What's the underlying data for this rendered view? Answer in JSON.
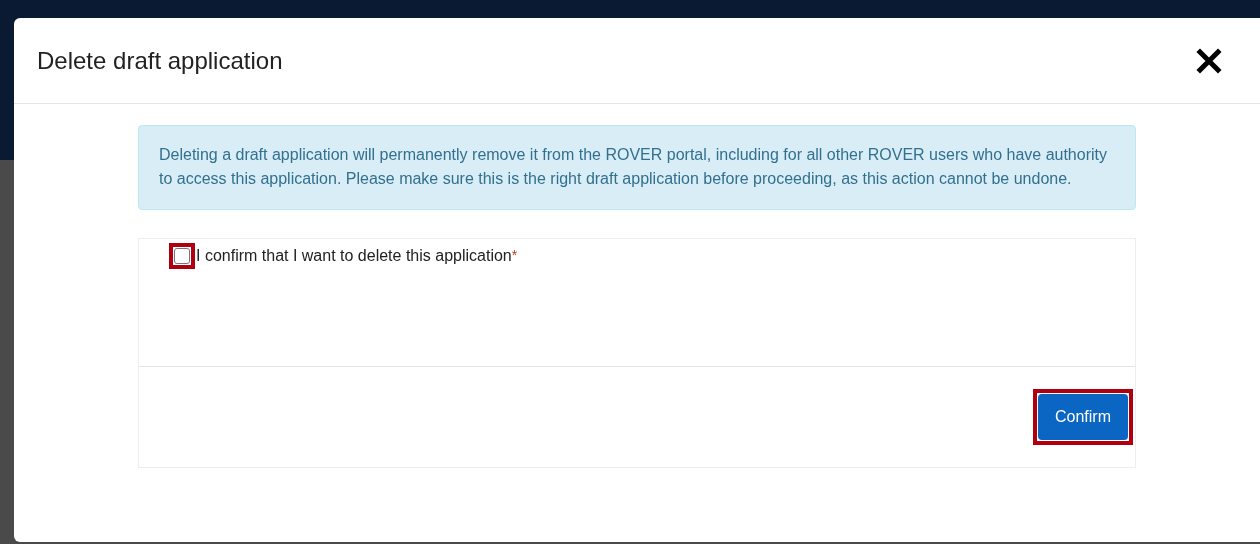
{
  "dialog": {
    "title": "Delete draft application"
  },
  "alert": {
    "text": "Deleting a draft application will permanently remove it from the ROVER portal, including for all other ROVER users who have authority to access this application. Please make sure this is the right draft application before proceeding, as this action cannot be undone."
  },
  "confirm_checkbox": {
    "label": "I confirm that I want to delete this application",
    "required_mark": "*",
    "checked": false,
    "highlighted": true
  },
  "confirm_button": {
    "label": "Confirm",
    "highlighted": true
  }
}
